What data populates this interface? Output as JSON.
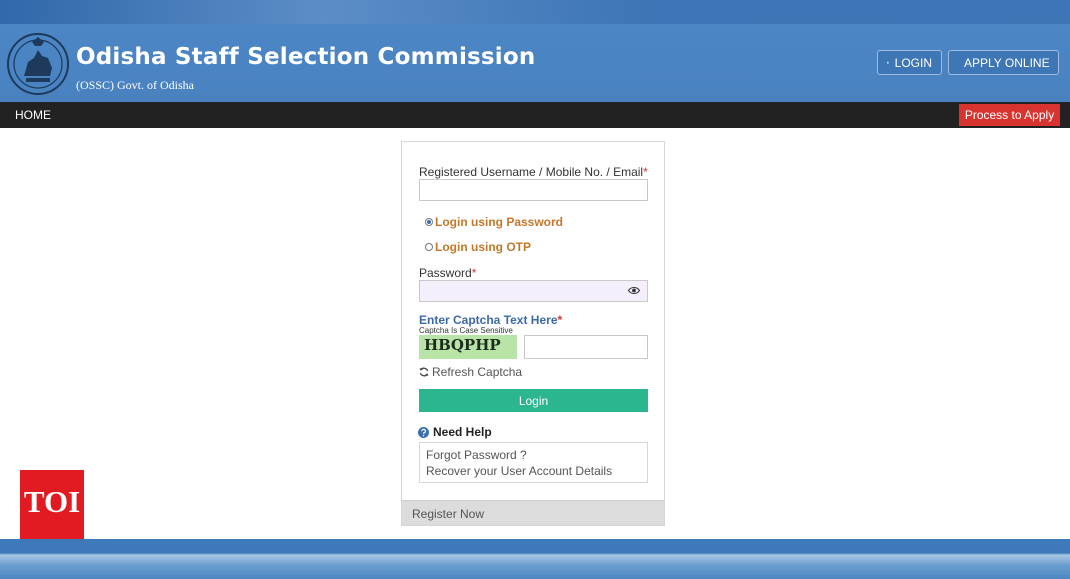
{
  "header": {
    "title": "Odisha Staff Selection Commission",
    "subtitle": "(OSSC) Govt. of Odisha",
    "login_label": "LOGIN",
    "apply_label": "APPLY ONLINE",
    "emblem_icon": "odisha-emblem-icon"
  },
  "nav": {
    "home_label": "HOME",
    "process_label": "Process to Apply"
  },
  "form": {
    "username_label": "Registered Username / Mobile No. / Email",
    "required_mark": "*",
    "username_value": "",
    "login_options": [
      {
        "label": "Login using Password",
        "selected": true
      },
      {
        "label": "Login using OTP",
        "selected": false
      }
    ],
    "password_label": "Password",
    "password_value": "",
    "captcha_title": "Enter Captcha Text Here",
    "captcha_hint": "Captcha Is Case Sensitive",
    "captcha_text": "HBQPHP",
    "captcha_value": "",
    "refresh_label": "Refresh Captcha",
    "login_button": "Login",
    "help_title": "Need Help",
    "help_links": [
      "Forgot Password ?",
      "Recover your User Account Details"
    ],
    "register_label": "Register Now"
  },
  "watermark": {
    "text": "TOI"
  },
  "colors": {
    "header_blue": "#4a82c0",
    "navbar": "#222222",
    "process_red": "#d9332f",
    "login_green": "#2cb690",
    "option_orange": "#c2782a",
    "captcha_blue": "#3b6aa8",
    "toi_red": "#e21b22"
  }
}
